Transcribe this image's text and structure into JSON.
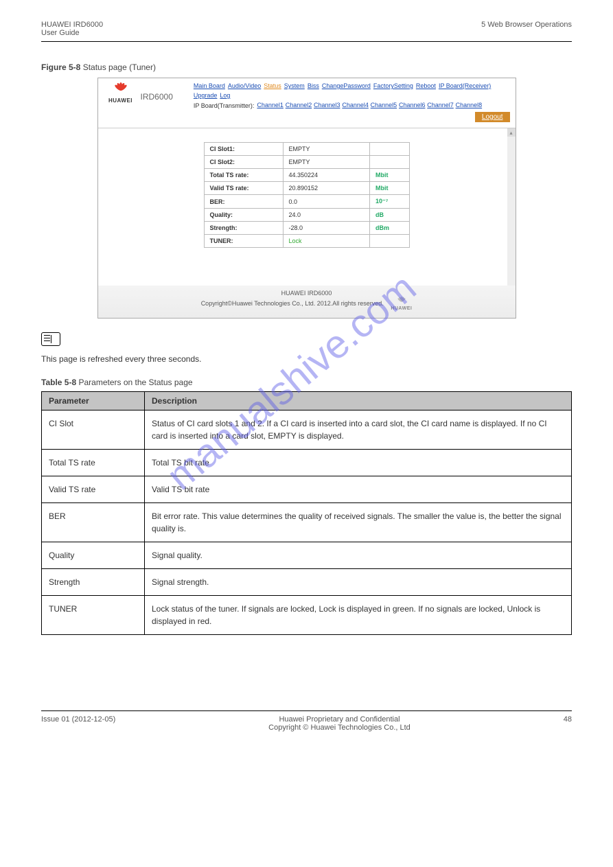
{
  "header": {
    "left_line1": "HUAWEI IRD6000",
    "left_line2": "User Guide",
    "right": "5 Web Browser Operations"
  },
  "figure": {
    "label_prefix": "Figure 5-8",
    "label_text": " Status page (Tuner)"
  },
  "screenshot": {
    "brand": "HUAWEI",
    "model": "IRD6000",
    "nav1": [
      "Main Board",
      "Audio/Video",
      "Status",
      "System",
      "Biss",
      "ChangePassword",
      "FactorySetting",
      "Reboot",
      "IP Board(Receiver)",
      "Upgrade",
      "Log"
    ],
    "nav1_active_index": 2,
    "nav2_label": "IP Board(Transmitter):",
    "nav2": [
      "Channel1",
      "Channel2",
      "Channel3",
      "Channel4",
      "Channel5",
      "Channel6",
      "Channel7",
      "Channel8"
    ],
    "logout": "Logout",
    "rows": [
      {
        "label": "CI Slot1:",
        "value": "EMPTY",
        "unit": ""
      },
      {
        "label": "CI Slot2:",
        "value": "EMPTY",
        "unit": ""
      },
      {
        "label": "Total TS rate:",
        "value": "44.350224",
        "unit": "Mbit"
      },
      {
        "label": "Valid TS rate:",
        "value": "20.890152",
        "unit": "Mbit"
      },
      {
        "label": "BER:",
        "value": "0.0",
        "unit": "10⁻⁷"
      },
      {
        "label": "Quality:",
        "value": "24.0",
        "unit": "dB"
      },
      {
        "label": "Strength:",
        "value": "-28.0",
        "unit": "dBm"
      },
      {
        "label": "TUNER:",
        "value": "Lock",
        "unit": "",
        "lock": true
      }
    ],
    "footer_line1": "HUAWEI IRD6000",
    "footer_line2": "Copyright©Huawei Technologies Co., Ltd. 2012.All rights reserved."
  },
  "note": "This page is refreshed every three seconds.",
  "table_caption": {
    "prefix": "Table 5-8",
    "text": " Parameters on the Status page"
  },
  "params_header": {
    "c1": "Parameter",
    "c2": "Description"
  },
  "params": [
    {
      "p": "CI Slot",
      "d": "Status of CI card slots 1 and 2. If a CI card is inserted into a card slot, the CI card name is displayed. If no CI card is inserted into a card slot, EMPTY is displayed."
    },
    {
      "p": "Total TS rate",
      "d": "Total TS bit rate"
    },
    {
      "p": "Valid TS rate",
      "d": "Valid TS bit rate"
    },
    {
      "p": "BER",
      "d": "Bit error rate. This value determines the quality of received signals. The smaller the value is, the better the signal quality is."
    },
    {
      "p": "Quality",
      "d": "Signal quality."
    },
    {
      "p": "Strength",
      "d": "Signal strength."
    },
    {
      "p": "TUNER",
      "d": "Lock status of the tuner. If signals are locked, Lock is displayed in green. If no signals are locked, Unlock is displayed in red."
    }
  ],
  "footer": {
    "left_line1": "Issue 01 (2012-12-05)",
    "right_line1": "Huawei Proprietary and Confidential",
    "right_line2": "Copyright © Huawei Technologies Co., Ltd",
    "page": "48"
  },
  "watermark": "manualshive.com"
}
